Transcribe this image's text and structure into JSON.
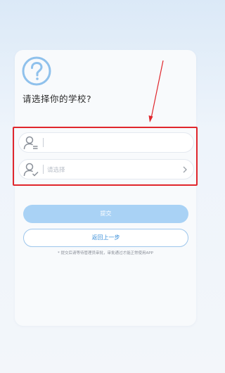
{
  "title": "请选择你的学校?",
  "fields": [
    {
      "value": "",
      "placeholder": ""
    },
    {
      "value": "",
      "placeholder": "请选择"
    }
  ],
  "buttons": {
    "submit": "提交",
    "back": "返回上一步"
  },
  "hint": "* 提交后请等待管理员审批，审批通过才能正常使用APP",
  "icons": {
    "question": "question-circle-icon",
    "field1": "user-list-icon",
    "field2": "user-check-icon",
    "chevron": "chevron-right-icon"
  },
  "colors": {
    "accent": "#3a8fd9",
    "submit_bg": "#a9d2f5",
    "annotation": "#e0262c"
  }
}
